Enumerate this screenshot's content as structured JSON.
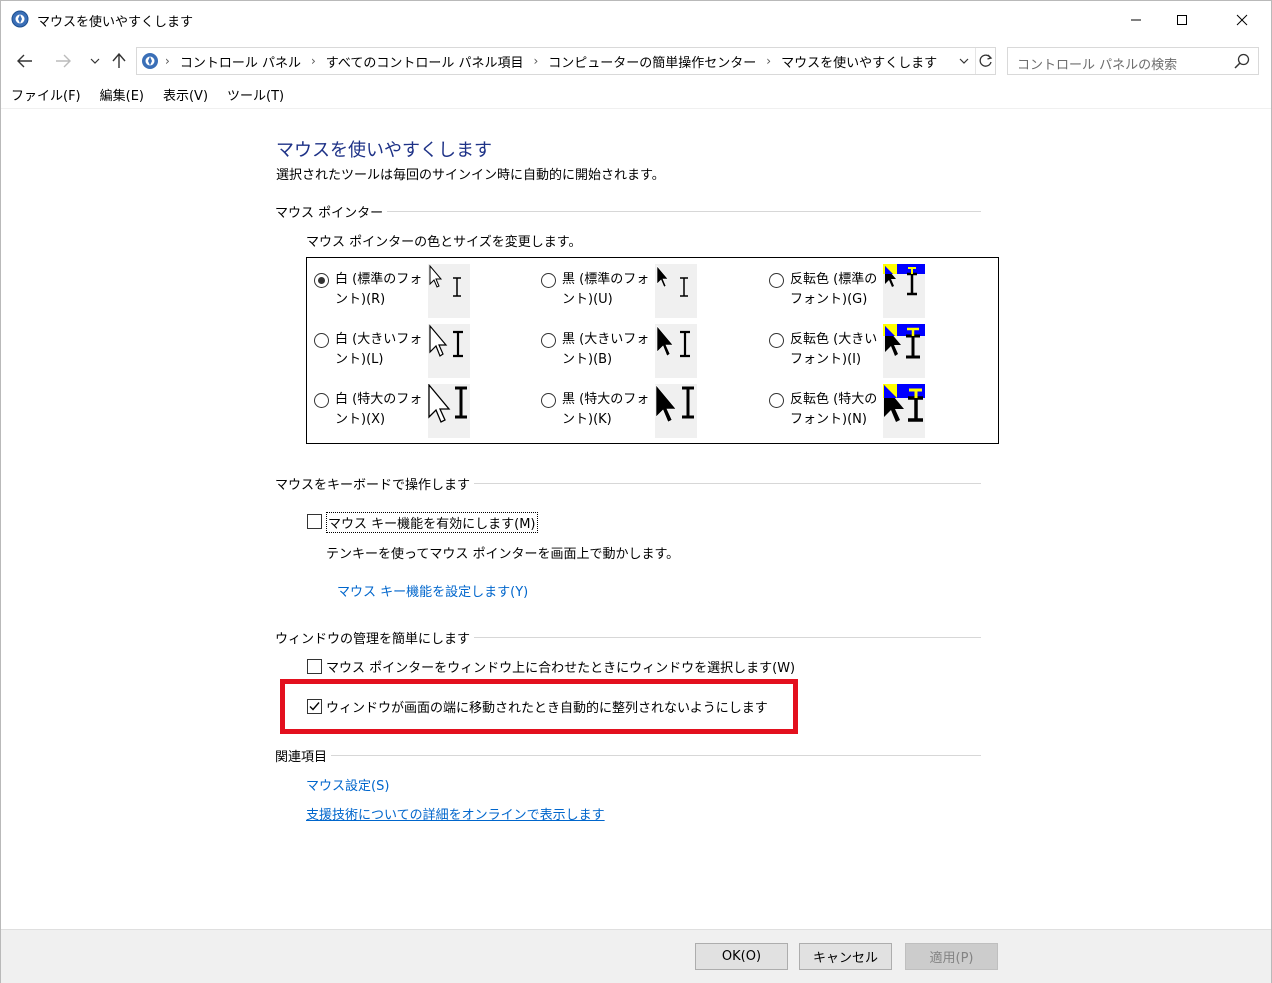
{
  "window": {
    "title": "マウスを使いやすくします",
    "icon": "control-panel-icon"
  },
  "nav": {
    "breadcrumbs": [
      "コントロール パネル",
      "すべてのコントロール パネル項目",
      "コンピューターの簡単操作センター",
      "マウスを使いやすくします"
    ],
    "search_placeholder": "コントロール パネルの検索"
  },
  "menu": {
    "items": [
      "ファイル(F)",
      "編集(E)",
      "表示(V)",
      "ツール(T)"
    ]
  },
  "page": {
    "title": "マウスを使いやすくします",
    "subtitle": "選択されたツールは毎回のサインイン時に自動的に開始されます。"
  },
  "pointer_section": {
    "heading": "マウス ポインター",
    "description": "マウス ポインターの色とサイズを変更します。",
    "options": [
      {
        "label": "白 (標準のフォント)(R)",
        "style": "white",
        "size": "standard",
        "selected": true
      },
      {
        "label": "黒 (標準のフォント)(U)",
        "style": "black",
        "size": "standard",
        "selected": false
      },
      {
        "label": "反転色 (標準のフォント)(G)",
        "style": "invert",
        "size": "standard",
        "selected": false
      },
      {
        "label": "白 (大きいフォント)(L)",
        "style": "white",
        "size": "large",
        "selected": false
      },
      {
        "label": "黒 (大きいフォント)(B)",
        "style": "black",
        "size": "large",
        "selected": false
      },
      {
        "label": "反転色 (大きいフォント)(I)",
        "style": "invert",
        "size": "large",
        "selected": false
      },
      {
        "label": "白 (特大のフォント)(X)",
        "style": "white",
        "size": "xlarge",
        "selected": false
      },
      {
        "label": "黒 (特大のフォント)(K)",
        "style": "black",
        "size": "xlarge",
        "selected": false
      },
      {
        "label": "反転色 (特大のフォント)(N)",
        "style": "invert",
        "size": "xlarge",
        "selected": false
      }
    ]
  },
  "keyboard_section": {
    "heading": "マウスをキーボードで操作します",
    "mousekeys_label": "マウス キー機能を有効にします(M)",
    "mousekeys_checked": false,
    "mousekeys_desc": "テンキーを使ってマウス ポインターを画面上で動かします。",
    "mousekeys_link": "マウス キー機能を設定します(Y)"
  },
  "window_section": {
    "heading": "ウィンドウの管理を簡単にします",
    "hover_activate_label": "マウス ポインターをウィンドウ上に合わせたときにウィンドウを選択します(W)",
    "hover_activate_checked": false,
    "prevent_snap_label": "ウィンドウが画面の端に移動されたとき自動的に整列されないようにします",
    "prevent_snap_checked": true
  },
  "related_section": {
    "heading": "関連項目",
    "link1": "マウス設定(S)",
    "link2": "支援技術についての詳細をオンラインで表示します"
  },
  "buttons": {
    "ok": "OK(O)",
    "cancel": "キャンセル",
    "apply": "適用(P)"
  },
  "colors": {
    "title_blue": "#1e3287",
    "link_blue": "#0066cc",
    "highlight_red": "#e3101e",
    "invert_blue": "#0000ff",
    "invert_yellow": "#ffff00"
  }
}
